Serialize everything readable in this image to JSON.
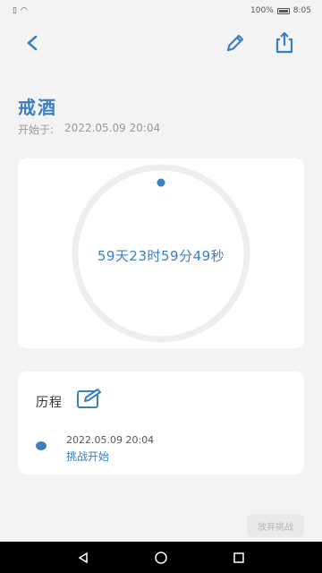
{
  "status_bar": {
    "left_icons": [
      "sim-icon",
      "wifi-icon"
    ],
    "battery_percent": "100%",
    "time": "8:05"
  },
  "header": {
    "icons": [
      "back-icon",
      "pencil-icon",
      "share-icon"
    ]
  },
  "goal": {
    "title": "戒酒",
    "start_label": "开始于:",
    "start_datetime": "2022.05.09 20:04"
  },
  "timer": {
    "elapsed_text": "59天23时59分49秒"
  },
  "history": {
    "title": "历程",
    "entries": [
      {
        "date": "2022.05.09 20:04",
        "label": "挑战开始"
      }
    ]
  },
  "actions": {
    "challenge_button_label": "放弃挑战"
  },
  "colors": {
    "accent": "#3a7fc0",
    "background": "#f3f3f3",
    "card": "#ffffff"
  }
}
